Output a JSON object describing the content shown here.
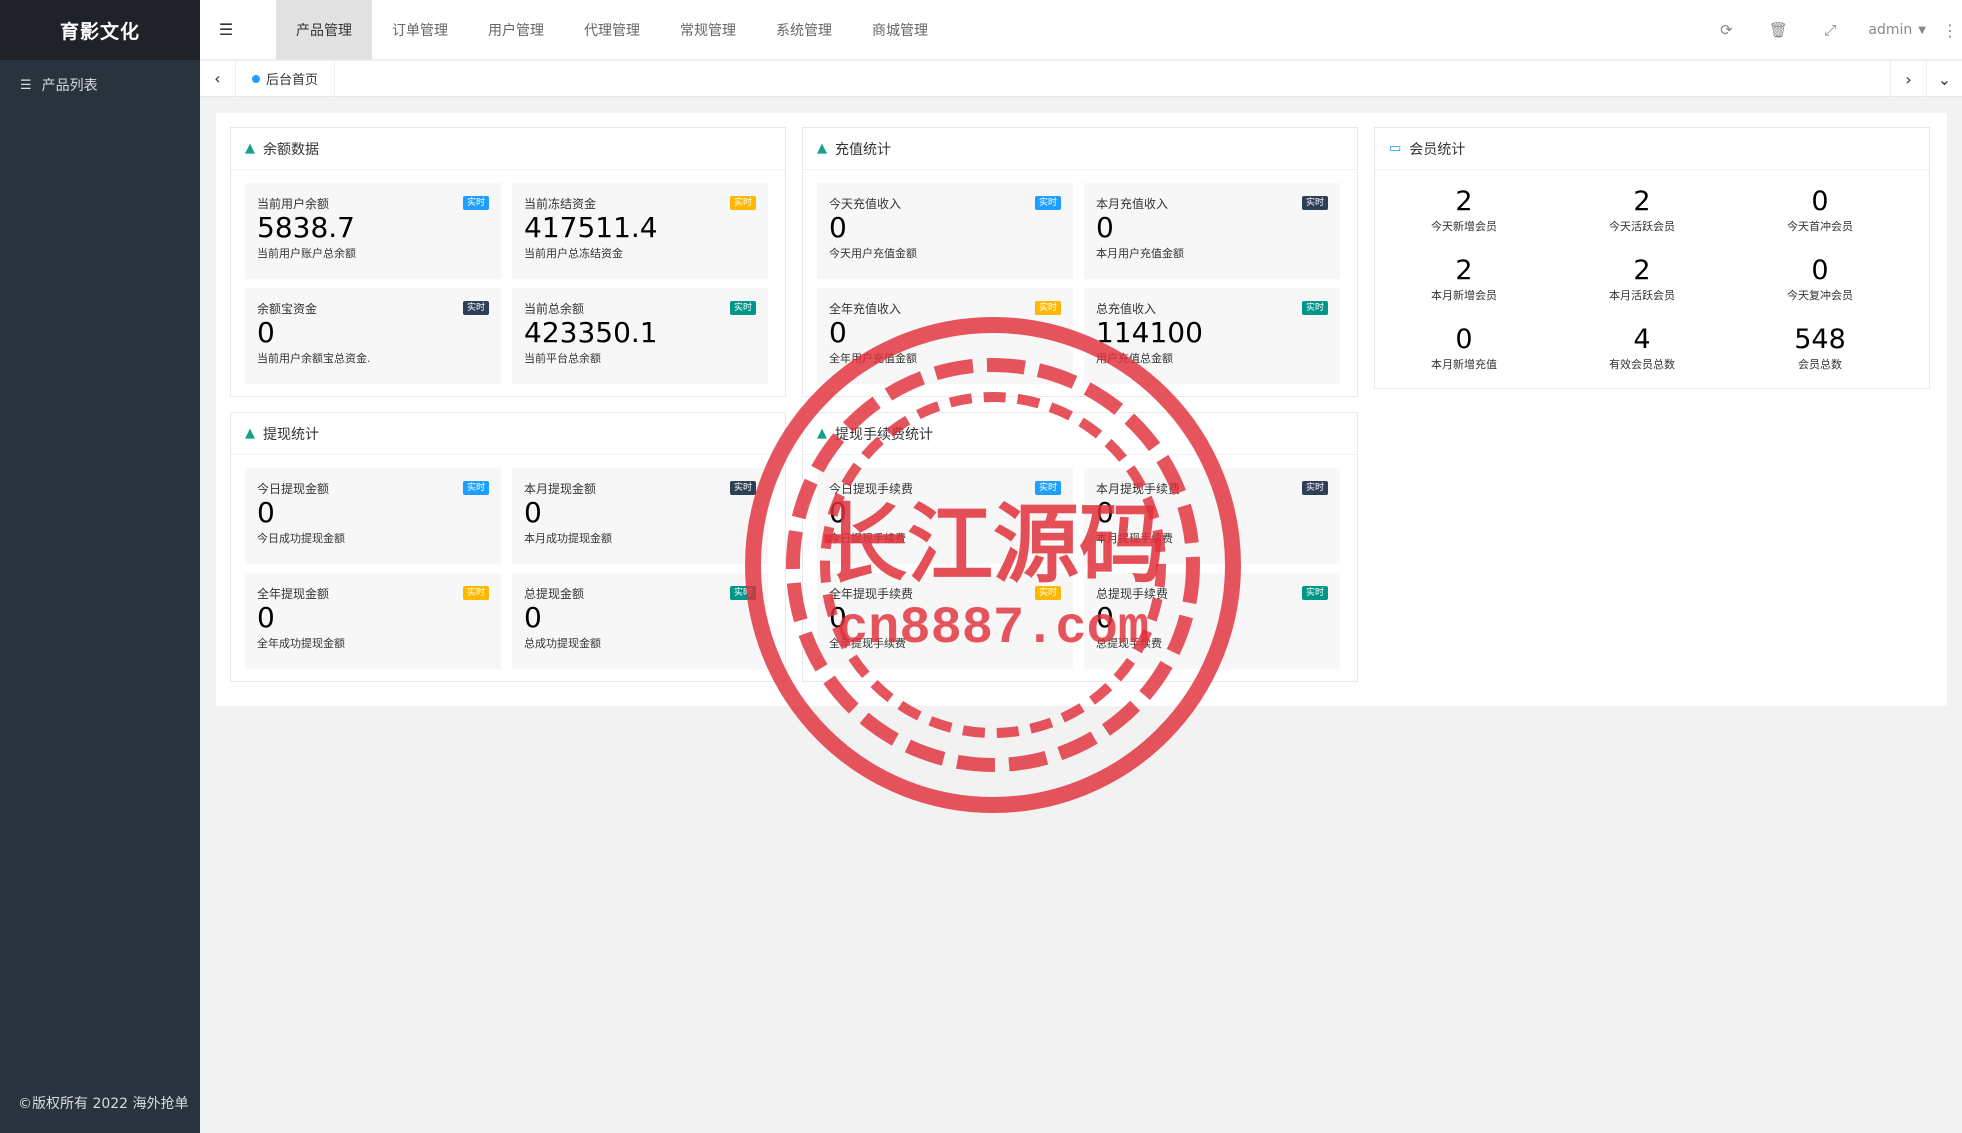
{
  "sidebar": {
    "logo": "育影文化",
    "items": [
      {
        "icon": "list-icon",
        "label": "产品列表"
      }
    ],
    "copyright": "©版权所有 2022 海外抢单"
  },
  "header": {
    "nav": [
      "产品管理",
      "订单管理",
      "用户管理",
      "代理管理",
      "常规管理",
      "系统管理",
      "商城管理"
    ],
    "active_index": 0,
    "user": "admin"
  },
  "tabs": {
    "home": "后台首页"
  },
  "panels": {
    "balance": {
      "title": "余额数据",
      "cards": [
        {
          "label": "当前用户余额",
          "value": "5838.7",
          "sub": "当前用户账户总余额",
          "badge": "实时",
          "color": "#1e9fff"
        },
        {
          "label": "当前冻结资金",
          "value": "417511.4",
          "sub": "当前用户总冻结资金",
          "badge": "实时",
          "color": "#ffb800"
        },
        {
          "label": "余额宝资金",
          "value": "0",
          "sub": "当前用户余额宝总资金.",
          "badge": "实时",
          "color": "#2f4056"
        },
        {
          "label": "当前总余额",
          "value": "423350.1",
          "sub": "当前平台总余额",
          "badge": "实时",
          "color": "#009688"
        }
      ]
    },
    "recharge": {
      "title": "充值统计",
      "cards": [
        {
          "label": "今天充值收入",
          "value": "0",
          "sub": "今天用户充值金额",
          "badge": "实时",
          "color": "#1e9fff"
        },
        {
          "label": "本月充值收入",
          "value": "0",
          "sub": "本月用户充值金额",
          "badge": "实时",
          "color": "#2f4056"
        },
        {
          "label": "全年充值收入",
          "value": "0",
          "sub": "全年用户充值金额",
          "badge": "实时",
          "color": "#ffb800"
        },
        {
          "label": "总充值收入",
          "value": "114100",
          "sub": "用户充值总金额",
          "badge": "实时",
          "color": "#009688"
        }
      ]
    },
    "members": {
      "title": "会员统计",
      "cells": [
        {
          "value": "2",
          "label": "今天新增会员"
        },
        {
          "value": "2",
          "label": "今天活跃会员"
        },
        {
          "value": "0",
          "label": "今天首冲会员"
        },
        {
          "value": "2",
          "label": "本月新增会员"
        },
        {
          "value": "2",
          "label": "本月活跃会员"
        },
        {
          "value": "0",
          "label": "今天复冲会员"
        },
        {
          "value": "0",
          "label": "本月新增充值"
        },
        {
          "value": "4",
          "label": "有效会员总数"
        },
        {
          "value": "548",
          "label": "会员总数"
        }
      ]
    },
    "withdraw": {
      "title": "提现统计",
      "cards": [
        {
          "label": "今日提现金额",
          "value": "0",
          "sub": "今日成功提现金额",
          "badge": "实时",
          "color": "#1e9fff"
        },
        {
          "label": "本月提现金额",
          "value": "0",
          "sub": "本月成功提现金额",
          "badge": "实时",
          "color": "#2f4056"
        },
        {
          "label": "全年提现金额",
          "value": "0",
          "sub": "全年成功提现金额",
          "badge": "实时",
          "color": "#ffb800"
        },
        {
          "label": "总提现金额",
          "value": "0",
          "sub": "总成功提现金额",
          "badge": "实时",
          "color": "#009688"
        }
      ]
    },
    "fee": {
      "title": "提现手续费统计",
      "cards": [
        {
          "label": "今日提现手续费",
          "value": "0",
          "sub": "今日提现手续费",
          "badge": "实时",
          "color": "#1e9fff"
        },
        {
          "label": "本月提现手续费",
          "value": "0",
          "sub": "本月提现手续费",
          "badge": "实时",
          "color": "#2f4056"
        },
        {
          "label": "全年提现手续费",
          "value": "0",
          "sub": "全年提现手续费",
          "badge": "实时",
          "color": "#ffb800"
        },
        {
          "label": "总提现手续费",
          "value": "0",
          "sub": "总提现手续费",
          "badge": "实时",
          "color": "#009688"
        }
      ]
    }
  },
  "watermark": {
    "text": "长江源码",
    "url": "cn8887.com",
    "color": "#e0303a"
  }
}
